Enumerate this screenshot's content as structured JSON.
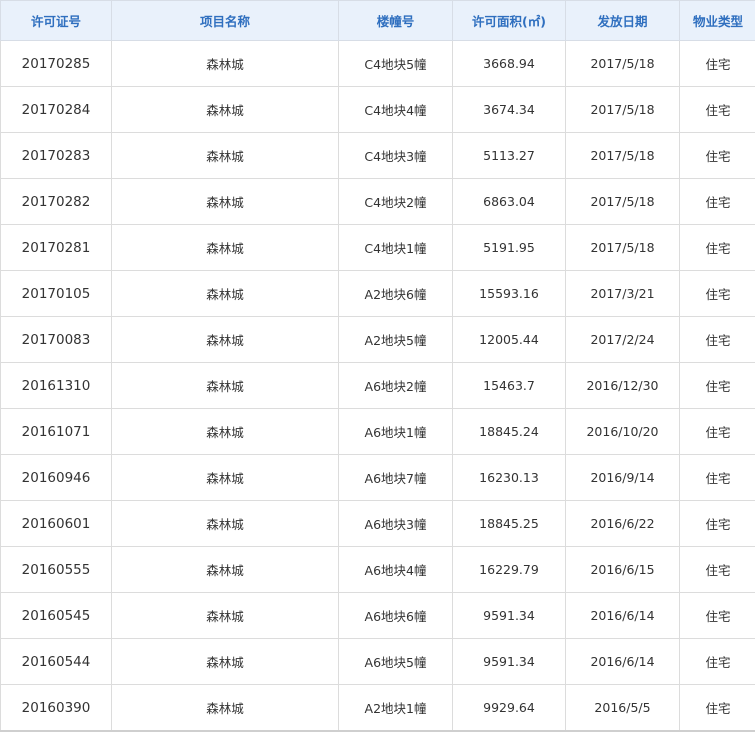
{
  "table": {
    "headers": [
      "许可证号",
      "项目名称",
      "楼幢号",
      "许可面积(㎡)",
      "发放日期",
      "物业类型"
    ],
    "rows": [
      [
        "20170285",
        "森林城",
        "C4地块5幢",
        "3668.94",
        "2017/5/18",
        "住宅"
      ],
      [
        "20170284",
        "森林城",
        "C4地块4幢",
        "3674.34",
        "2017/5/18",
        "住宅"
      ],
      [
        "20170283",
        "森林城",
        "C4地块3幢",
        "5113.27",
        "2017/5/18",
        "住宅"
      ],
      [
        "20170282",
        "森林城",
        "C4地块2幢",
        "6863.04",
        "2017/5/18",
        "住宅"
      ],
      [
        "20170281",
        "森林城",
        "C4地块1幢",
        "5191.95",
        "2017/5/18",
        "住宅"
      ],
      [
        "20170105",
        "森林城",
        "A2地块6幢",
        "15593.16",
        "2017/3/21",
        "住宅"
      ],
      [
        "20170083",
        "森林城",
        "A2地块5幢",
        "12005.44",
        "2017/2/24",
        "住宅"
      ],
      [
        "20161310",
        "森林城",
        "A6地块2幢",
        "15463.7",
        "2016/12/30",
        "住宅"
      ],
      [
        "20161071",
        "森林城",
        "A6地块1幢",
        "18845.24",
        "2016/10/20",
        "住宅"
      ],
      [
        "20160946",
        "森林城",
        "A6地块7幢",
        "16230.13",
        "2016/9/14",
        "住宅"
      ],
      [
        "20160601",
        "森林城",
        "A6地块3幢",
        "18845.25",
        "2016/6/22",
        "住宅"
      ],
      [
        "20160555",
        "森林城",
        "A6地块4幢",
        "16229.79",
        "2016/6/15",
        "住宅"
      ],
      [
        "20160545",
        "森林城",
        "A6地块6幢",
        "9591.34",
        "2016/6/14",
        "住宅"
      ],
      [
        "20160544",
        "森林城",
        "A6地块5幢",
        "9591.34",
        "2016/6/14",
        "住宅"
      ],
      [
        "20160390",
        "森林城",
        "A2地块1幢",
        "9929.64",
        "2016/5/5",
        "住宅"
      ]
    ]
  },
  "colors": {
    "header_bg": "#e9f1fb",
    "header_text": "#2f6fbf",
    "cell_text": "#333333",
    "border": "#dcdcdc"
  }
}
